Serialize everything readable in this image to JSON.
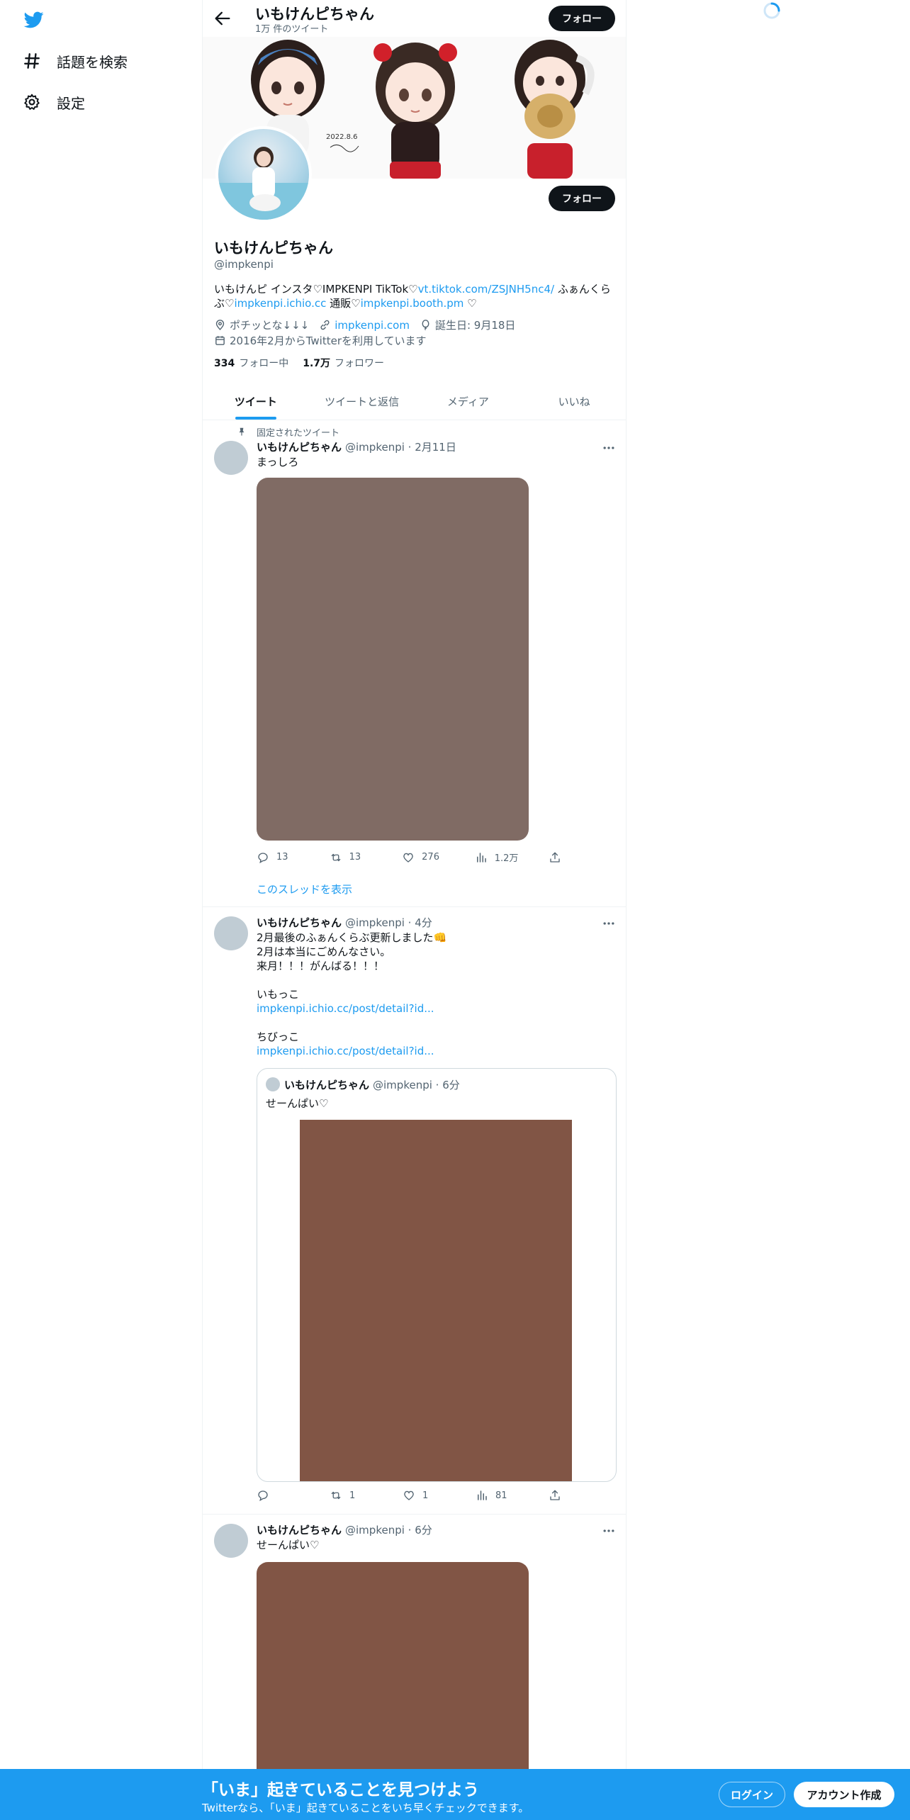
{
  "nav": {
    "explore_label": "話題を検索",
    "settings_label": "設定"
  },
  "header": {
    "title": "いもけんピちゃん",
    "tweet_count": "1万 件のツイート",
    "follow_label": "フォロー"
  },
  "banner": {
    "signature": "2022.8.6"
  },
  "profile": {
    "name": "いもけんピちゃん",
    "handle": "@impkenpi",
    "follow_label": "フォロー",
    "bio": {
      "text1": "いもけんピ インスタ♡IMPKENPI TikTok♡",
      "link1": "vt.tiktok.com/ZSJNH5nc4/",
      "text2": " ふぁんくらぶ♡",
      "link2": "impkenpi.ichio.cc",
      "text3": " 通販♡",
      "link3": "impkenpi.booth.pm",
      "text4": " ♡"
    },
    "location": "ポチッとな↓↓↓",
    "website": "impkenpi.com",
    "birthday": "誕生日: 9月18日",
    "joined": "2016年2月からTwitterを利用しています",
    "following_count": "334",
    "following_label": "フォロー中",
    "followers_count": "1.7万",
    "followers_label": "フォロワー"
  },
  "tabs": [
    "ツイート",
    "ツイートと返信",
    "メディア",
    "いいね"
  ],
  "tweets": [
    {
      "pinned_label": "固定されたツイート",
      "name": "いもけんピちゃん",
      "meta": "@impkenpi · 2月11日",
      "text": "まっしろ",
      "media_color": "#806b64",
      "replies": "13",
      "retweets": "13",
      "likes": "276",
      "views": "1.2万",
      "show_thread": "このスレッドを表示"
    },
    {
      "name": "いもけんピちゃん",
      "meta": "@impkenpi · 4分",
      "line1": "2月最後のふぁんくらぶ更新しました👊",
      "line2": "2月は本当にごめんなさい。",
      "line3": "来月！！！がんばる！！！",
      "line4": "いもっこ",
      "link1": "impkenpi.ichio.cc/post/detail?id...",
      "line5": "ちびっこ",
      "link2": "impkenpi.ichio.cc/post/detail?id...",
      "quote": {
        "name": "いもけんピちゃん",
        "meta": "@impkenpi · 6分",
        "text": "せーんぱい♡",
        "media_color": "#815545"
      },
      "replies": "",
      "retweets": "1",
      "likes": "1",
      "views": "81"
    },
    {
      "name": "いもけんピちゃん",
      "meta": "@impkenpi · 6分",
      "text": "せーんぱい♡",
      "media_color": "#815545"
    }
  ],
  "bottom_bar": {
    "title": "「いま」起きていることを見つけよう",
    "subtitle": "Twitterなら、「いま」起きていることをいち早くチェックできます。",
    "login_label": "ログイン",
    "signup_label": "アカウント作成"
  },
  "colors": {
    "accent": "#1d9bf0",
    "text": "#0f1419",
    "secondary_text": "#536471"
  }
}
